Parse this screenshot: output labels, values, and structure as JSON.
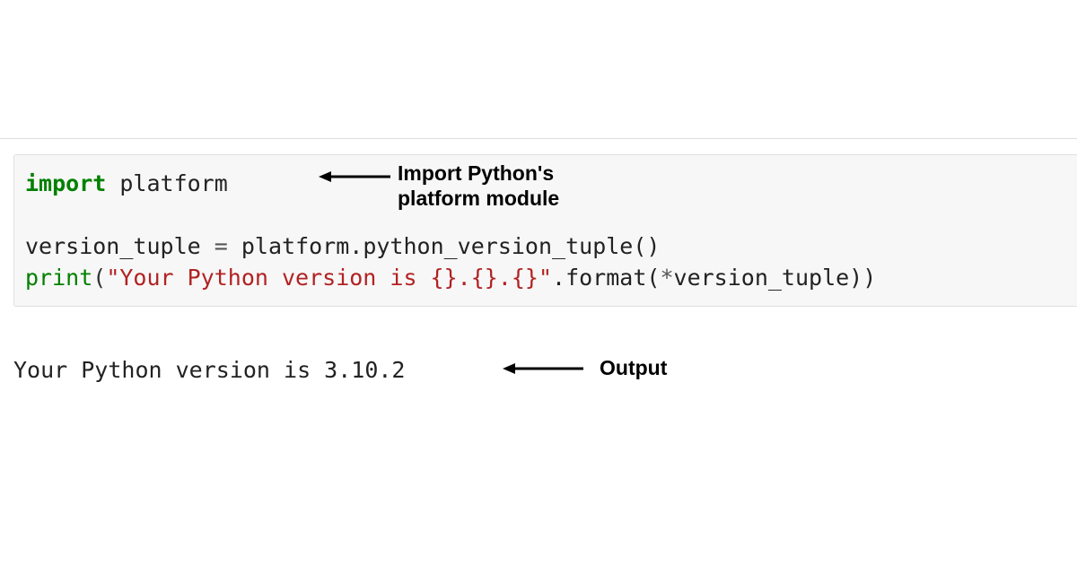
{
  "code": {
    "line1": {
      "kw": "import",
      "sp": " ",
      "mod": "platform"
    },
    "line2": {
      "var": "version_tuple",
      "sp1": " ",
      "eq": "=",
      "sp2": " ",
      "call": "platform.python_version_tuple()"
    },
    "line3": {
      "fn": "print",
      "open": "(",
      "str": "\"Your Python version is {}.{}.{}\"",
      "dot": ".format(",
      "star": "*",
      "arg": "version_tuple))"
    }
  },
  "output": "Your Python version is 3.10.2",
  "annotations": {
    "import_label": "Import Python's\nplatform module",
    "output_label": "Output"
  }
}
